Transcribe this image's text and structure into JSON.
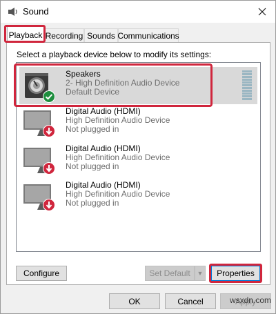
{
  "window": {
    "title": "Sound"
  },
  "tabs": [
    {
      "label": "Playback"
    },
    {
      "label": "Recording"
    },
    {
      "label": "Sounds"
    },
    {
      "label": "Communications"
    }
  ],
  "panel": {
    "instruction": "Select a playback device below to modify its settings:"
  },
  "devices": [
    {
      "name": "Speakers",
      "description": "2- High Definition Audio Device",
      "status": "Default Device",
      "icon": "speaker-icon",
      "badge": "green-check-badge-icon",
      "selected": true
    },
    {
      "name": "Digital Audio (HDMI)",
      "description": "High Definition Audio Device",
      "status": "Not plugged in",
      "icon": "monitor-icon",
      "badge": "red-down-arrow-badge-icon",
      "selected": false
    },
    {
      "name": "Digital Audio (HDMI)",
      "description": "High Definition Audio Device",
      "status": "Not plugged in",
      "icon": "monitor-icon",
      "badge": "red-down-arrow-badge-icon",
      "selected": false
    },
    {
      "name": "Digital Audio (HDMI)",
      "description": "High Definition Audio Device",
      "status": "Not plugged in",
      "icon": "monitor-icon",
      "badge": "red-down-arrow-badge-icon",
      "selected": false
    }
  ],
  "buttons": {
    "configure": "Configure",
    "set_default": "Set Default",
    "properties": "Properties",
    "ok": "OK",
    "cancel": "Cancel",
    "apply": "Apply"
  },
  "watermark": "wsxdn.com",
  "colors": {
    "highlight": "#d0263d",
    "check": "#1e8e3e",
    "unplugged": "#d0263d",
    "accent": "#0078d7"
  }
}
